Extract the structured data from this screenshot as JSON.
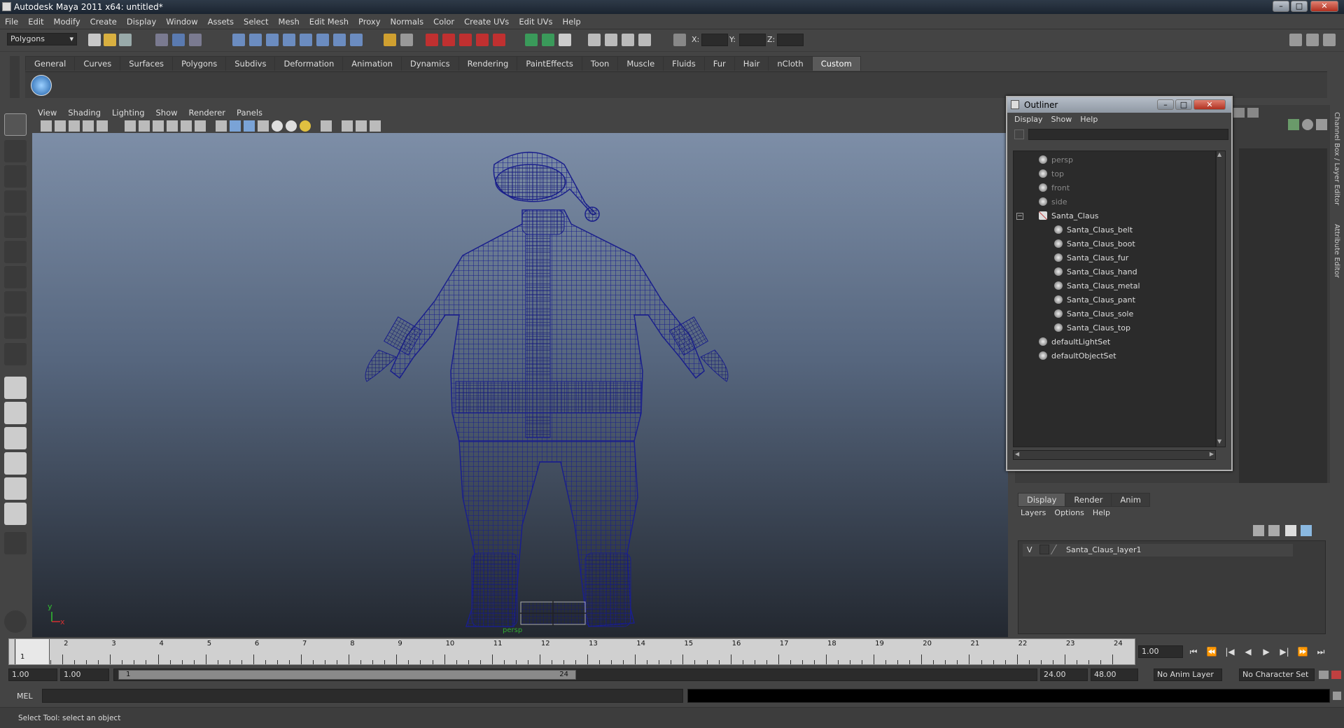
{
  "window": {
    "title": "Autodesk Maya 2011 x64: untitled*",
    "min": "–",
    "max": "□",
    "close": "✕"
  },
  "menubar": [
    "File",
    "Edit",
    "Modify",
    "Create",
    "Display",
    "Window",
    "Assets",
    "Select",
    "Mesh",
    "Edit Mesh",
    "Proxy",
    "Normals",
    "Color",
    "Create UVs",
    "Edit UVs",
    "Help"
  ],
  "toolbar": {
    "mode": "Polygons",
    "x_label": "X:",
    "y_label": "Y:",
    "z_label": "Z:"
  },
  "shelf_tabs": [
    "General",
    "Curves",
    "Surfaces",
    "Polygons",
    "Subdivs",
    "Deformation",
    "Animation",
    "Dynamics",
    "Rendering",
    "PaintEffects",
    "Toon",
    "Muscle",
    "Fluids",
    "Fur",
    "Hair",
    "nCloth",
    "Custom"
  ],
  "shelf_active": "Custom",
  "viewport": {
    "menu": [
      "View",
      "Shading",
      "Lighting",
      "Show",
      "Renderer",
      "Panels"
    ],
    "axis_y": "y",
    "axis_x": "x",
    "camera_label": "persp"
  },
  "outliner": {
    "title": "Outliner",
    "menu": [
      "Display",
      "Show",
      "Help"
    ],
    "items": [
      {
        "label": "persp",
        "dim": true,
        "indent": 0
      },
      {
        "label": "top",
        "dim": true,
        "indent": 0
      },
      {
        "label": "front",
        "dim": true,
        "indent": 0
      },
      {
        "label": "side",
        "dim": true,
        "indent": 0
      },
      {
        "label": "Santa_Claus",
        "dim": false,
        "indent": 0
      },
      {
        "label": "Santa_Claus_belt",
        "dim": false,
        "indent": 1
      },
      {
        "label": "Santa_Claus_boot",
        "dim": false,
        "indent": 1
      },
      {
        "label": "Santa_Claus_fur",
        "dim": false,
        "indent": 1
      },
      {
        "label": "Santa_Claus_hand",
        "dim": false,
        "indent": 1
      },
      {
        "label": "Santa_Claus_metal",
        "dim": false,
        "indent": 1
      },
      {
        "label": "Santa_Claus_pant",
        "dim": false,
        "indent": 1
      },
      {
        "label": "Santa_Claus_sole",
        "dim": false,
        "indent": 1
      },
      {
        "label": "Santa_Claus_top",
        "dim": false,
        "indent": 1
      },
      {
        "label": "defaultLightSet",
        "dim": false,
        "indent": 0
      },
      {
        "label": "defaultObjectSet",
        "dim": false,
        "indent": 0
      }
    ]
  },
  "side_tabs": [
    "Channel Box / Layer Editor",
    "Attribute Editor"
  ],
  "layers": {
    "tabs": [
      "Display",
      "Render",
      "Anim"
    ],
    "menu": [
      "Layers",
      "Options",
      "Help"
    ],
    "visible_flag": "V",
    "layer_name": "Santa_Claus_layer1"
  },
  "timeline": {
    "ticks": [
      "1",
      "2",
      "3",
      "4",
      "5",
      "6",
      "7",
      "8",
      "9",
      "10",
      "11",
      "12",
      "13",
      "14",
      "15",
      "16",
      "17",
      "18",
      "19",
      "20",
      "21",
      "22",
      "23",
      "24"
    ],
    "current_marker": "1",
    "current_time": "1.00"
  },
  "range": {
    "start": "1.00",
    "start2": "1.00",
    "slider_start": "1",
    "slider_end": "24",
    "end": "24.00",
    "end2": "48.00",
    "anim_layer": "No Anim Layer",
    "char_set": "No Character Set"
  },
  "cmdline": {
    "label": "MEL"
  },
  "helpline": {
    "text": "Select Tool: select an object"
  },
  "colors": {
    "wire": "#1a1f8c",
    "accent": "#4a90d9"
  }
}
